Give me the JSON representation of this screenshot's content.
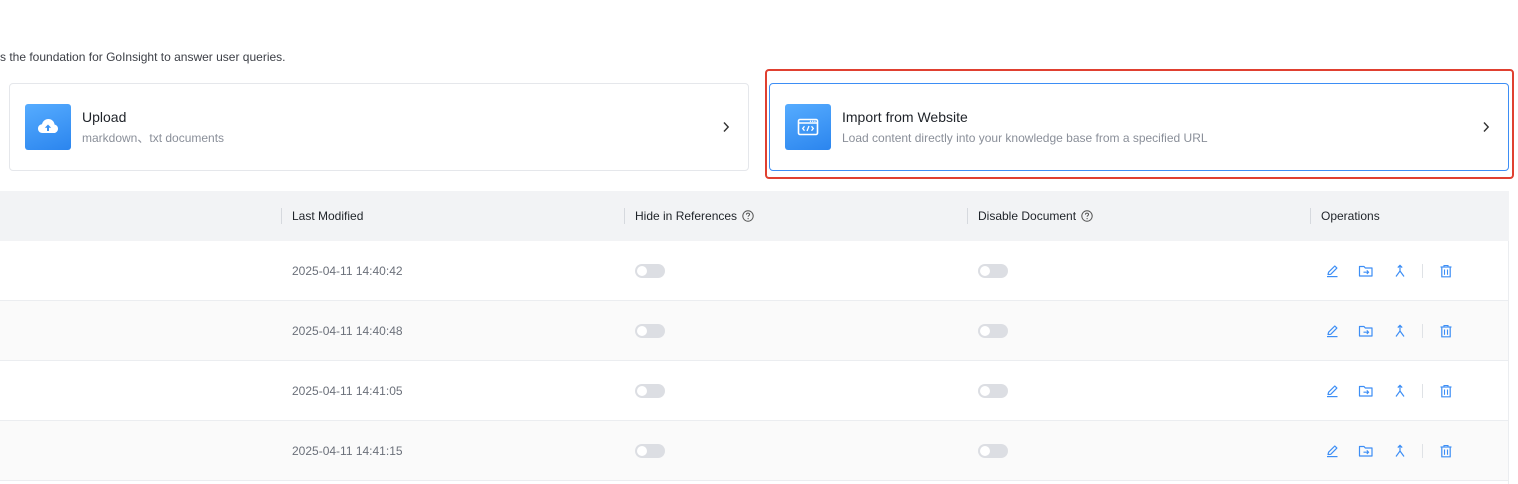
{
  "description": "s the foundation for GoInsight to answer user queries.",
  "cards": {
    "upload": {
      "title": "Upload",
      "subtitle": "markdown、txt documents",
      "icon": "cloud-upload-icon"
    },
    "website": {
      "title": "Import from Website",
      "subtitle": "Load content directly into your knowledge base from a specified URL",
      "icon": "web-code-icon"
    }
  },
  "table": {
    "columns": {
      "last_modified": "Last Modified",
      "hide_in_references": "Hide in References",
      "disable_document": "Disable Document",
      "operations": "Operations"
    },
    "rows": [
      {
        "last_modified": "2025-04-11 14:40:42",
        "hide_in_references": false,
        "disable_document": false
      },
      {
        "last_modified": "2025-04-11 14:40:48",
        "hide_in_references": false,
        "disable_document": false
      },
      {
        "last_modified": "2025-04-11 14:41:05",
        "hide_in_references": false,
        "disable_document": false
      },
      {
        "last_modified": "2025-04-11 14:41:15",
        "hide_in_references": false,
        "disable_document": false
      }
    ],
    "operation_icons": [
      "edit-icon",
      "move-to-folder-icon",
      "merge-icon",
      "delete-icon"
    ]
  },
  "colors": {
    "accent": "#3d8ef5",
    "highlight": "#e04030"
  }
}
